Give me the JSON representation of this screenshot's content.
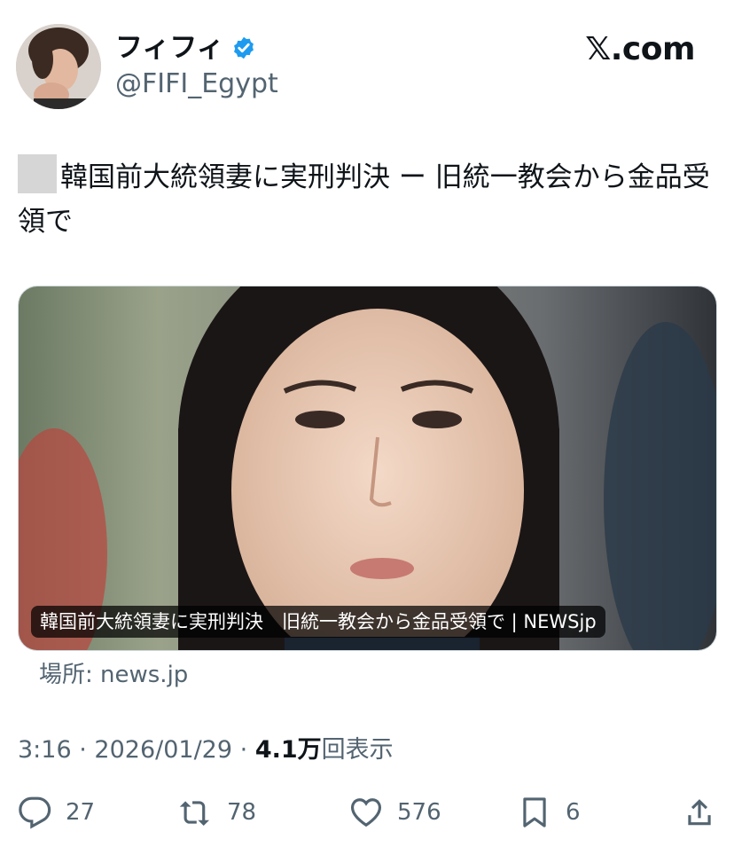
{
  "author": {
    "display_name": "フィフィ",
    "handle": "@FIFI_Egypt",
    "verified": true
  },
  "brand": {
    "label": "𝕏.com"
  },
  "tweet": {
    "text": "韓国前大統領妻に実刑判決 ー 旧統一教会から金品受領で"
  },
  "card": {
    "caption": "韓国前大統領妻に実刑判決　旧統一教会から金品受領で | NEWSjp",
    "source": "場所: news.jp"
  },
  "meta": {
    "time": "3:16",
    "separator": "·",
    "date": "2026/01/29",
    "views_count": "4.1万",
    "views_label": "回表示"
  },
  "actions": {
    "replies": "27",
    "reposts": "78",
    "likes": "576",
    "bookmarks": "6"
  },
  "icons": {
    "verified": "verified-badge-icon",
    "reply": "reply-icon",
    "repost": "repost-icon",
    "like": "heart-icon",
    "bookmark": "bookmark-icon",
    "share": "share-icon"
  },
  "colors": {
    "verified_blue": "#1d9bf0",
    "text_primary": "#0f1419",
    "text_secondary": "#536471"
  }
}
